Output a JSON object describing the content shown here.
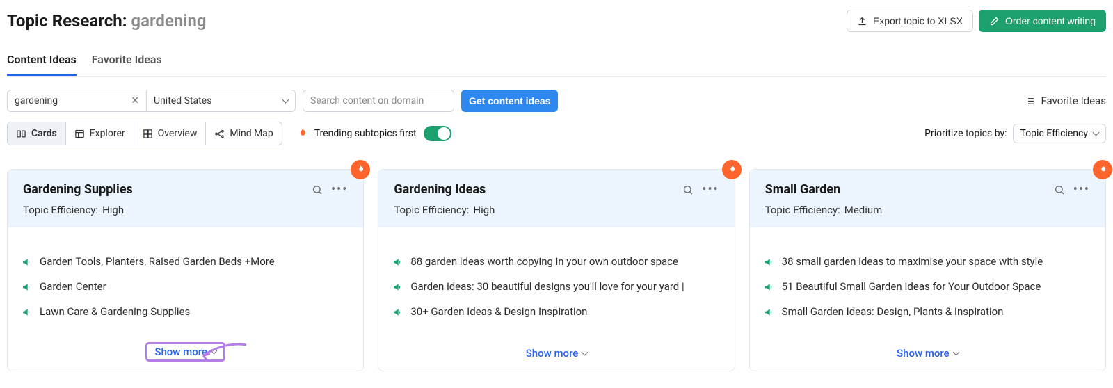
{
  "header": {
    "title_prefix": "Topic Research: ",
    "title_query": "gardening",
    "export_label": "Export topic to XLSX",
    "order_label": "Order content writing"
  },
  "tabs": [
    "Content Ideas",
    "Favorite Ideas"
  ],
  "active_tab": 0,
  "filters": {
    "topic_value": "gardening",
    "country_value": "United States",
    "domain_placeholder": "Search content on domain",
    "get_ideas_label": "Get content ideas",
    "favorite_link": "Favorite Ideas"
  },
  "views": [
    "Cards",
    "Explorer",
    "Overview",
    "Mind Map"
  ],
  "active_view": 0,
  "trending": {
    "label": "Trending subtopics first",
    "on": true
  },
  "prioritize": {
    "label": "Prioritize topics by:",
    "value": "Topic Efficiency"
  },
  "efficiency_label": "Topic Efficiency:",
  "show_more_label": "Show more",
  "cards": [
    {
      "title": "Gardening Supplies",
      "efficiency": "High",
      "trending": true,
      "ideas": [
        "Garden Tools, Planters, Raised Garden Beds +More",
        "Garden Center",
        "Lawn Care & Gardening Supplies"
      ],
      "highlight_show_more": true
    },
    {
      "title": "Gardening Ideas",
      "efficiency": "High",
      "trending": true,
      "ideas": [
        "88 garden ideas worth copying in your own outdoor space",
        "Garden ideas: 30 beautiful designs you'll love for your yard |",
        "30+ Garden Ideas & Design Inspiration"
      ],
      "highlight_show_more": false
    },
    {
      "title": "Small Garden",
      "efficiency": "Medium",
      "trending": true,
      "ideas": [
        "38 small garden ideas to maximise your space with style",
        "51 Beautiful Small Garden Ideas for Your Outdoor Space",
        "Small Garden Ideas: Design, Plants & Inspiration"
      ],
      "highlight_show_more": false
    }
  ]
}
